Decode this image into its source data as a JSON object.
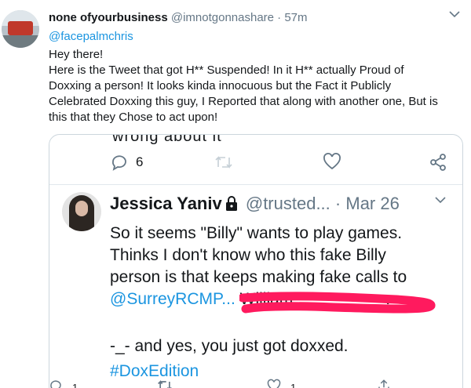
{
  "tweet": {
    "display_name": "none ofyourbusiness",
    "handle": "@imnotgonnashare",
    "separator": "·",
    "time": "57m",
    "reply_to": "@facepalmchris",
    "body_lines": [
      "Hey there!",
      "Here is the Tweet that got H** Suspended! In it H** actually Proud of",
      "Doxxing a person! It looks kinda innocuous but the Fact it Publicly",
      "Celebrated Doxxing this guy, I Reported that along with another one, But is",
      "this that they Chose to act upon!"
    ]
  },
  "quote_card": {
    "cut_text": "wrong about it",
    "actions": {
      "reply_count": "6",
      "retweet_count": "",
      "like_count": ""
    },
    "quoted_tweet": {
      "display_name": "Jessica Yaniv",
      "handle": "@trusted...",
      "separator": "·",
      "date": "Mar 26",
      "lines": [
        "So it seems \"Billy\" wants to play games.",
        "Thinks I don't know who this fake Billy",
        "person is that keeps making fake calls to"
      ],
      "mention": "@SurreyRCMP...",
      "redacted_prefix": "William",
      "trailing_period": ".",
      "line_after": "-_- and yes, you just got doxxed.",
      "hashtag_cut": "#DoxEdition"
    }
  },
  "bottom_actions": {
    "reply_count": "1",
    "like_count": "1"
  },
  "colors": {
    "link": "#1b95e0",
    "muted": "#657786",
    "border": "#ccd6dd",
    "scribble": "#ff1a5e"
  }
}
